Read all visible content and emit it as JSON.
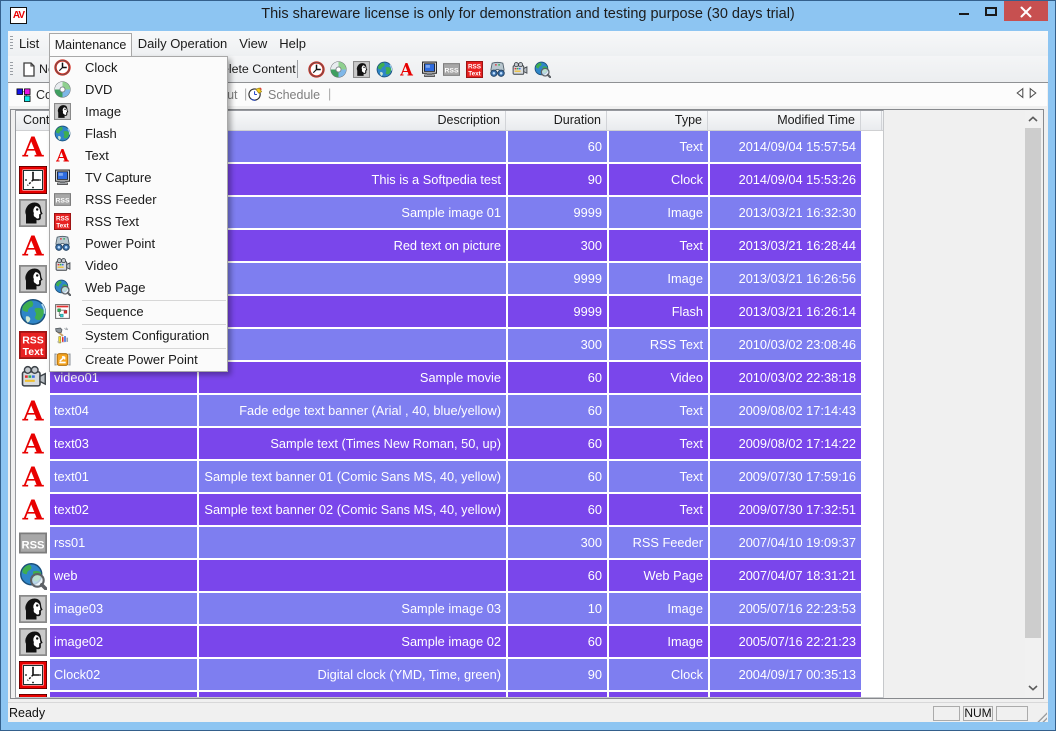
{
  "window": {
    "title": "This shareware license is only for demonstration and testing purpose (30 days trial)",
    "app_icon_text": "AV"
  },
  "menu_bar": {
    "items": [
      "List",
      "Maintenance",
      "Daily Operation",
      "View",
      "Help"
    ],
    "open_item": "Maintenance"
  },
  "maintenance_menu": {
    "items": [
      {
        "label": "Clock",
        "icon": "clock-icon"
      },
      {
        "label": "DVD",
        "icon": "dvd-icon"
      },
      {
        "label": "Image",
        "icon": "image-icon"
      },
      {
        "label": "Flash",
        "icon": "flash-icon"
      },
      {
        "label": "Text",
        "icon": "text-icon"
      },
      {
        "label": "TV Capture",
        "icon": "tv-capture-icon"
      },
      {
        "label": "RSS Feeder",
        "icon": "rss-feeder-icon"
      },
      {
        "label": "RSS Text",
        "icon": "rss-text-icon"
      },
      {
        "label": "Power Point",
        "icon": "power-point-icon"
      },
      {
        "label": "Video",
        "icon": "video-icon"
      },
      {
        "label": "Web Page",
        "icon": "web-page-icon"
      },
      {
        "separator": true
      },
      {
        "label": "Sequence",
        "icon": "sequence-icon"
      },
      {
        "separator": true
      },
      {
        "label": "System Configuration",
        "icon": "system-configuration-icon"
      },
      {
        "separator": true
      },
      {
        "label": "Create Power Point",
        "icon": "create-power-point-icon"
      }
    ]
  },
  "toolbar": {
    "new_button": {
      "label": "New Content",
      "icon": "new-content-icon"
    },
    "delete_button": {
      "label": "Delete Content",
      "icon": "delete-content-icon"
    },
    "icon_buttons": [
      {
        "name": "clock",
        "icon": "clock-icon"
      },
      {
        "name": "dvd",
        "icon": "dvd-icon"
      },
      {
        "name": "image",
        "icon": "image-icon"
      },
      {
        "name": "flash",
        "icon": "flash-icon"
      },
      {
        "name": "text",
        "icon": "text-icon"
      },
      {
        "name": "tv-capture",
        "icon": "tv-capture-icon"
      },
      {
        "name": "rss-feeder",
        "icon": "rss-feeder-icon"
      },
      {
        "name": "rss-text",
        "icon": "rss-text-icon"
      },
      {
        "name": "power-point",
        "icon": "power-point-icon"
      },
      {
        "name": "video",
        "icon": "video-icon"
      },
      {
        "name": "web-page",
        "icon": "web-page-icon"
      }
    ]
  },
  "tab_bar": {
    "tabs": [
      {
        "label": "Content",
        "icon": "content-tab-icon",
        "active": true
      },
      {
        "label": "Layout",
        "icon": "layout-tab-icon",
        "active": false
      },
      {
        "label": "Schedule",
        "icon": "schedule-tab-icon",
        "active": false
      }
    ]
  },
  "table": {
    "columns": [
      {
        "label": "Content Name",
        "align": "left"
      },
      {
        "label": "Description",
        "align": "right"
      },
      {
        "label": "Duration",
        "align": "right"
      },
      {
        "label": "Type",
        "align": "right"
      },
      {
        "label": "Modified Time",
        "align": "right"
      },
      {
        "label": "",
        "align": "left"
      }
    ],
    "rows": [
      {
        "icon": "text",
        "name": "",
        "description": "",
        "duration": "60",
        "type": "Text",
        "modified": "2014/09/04 15:57:54",
        "shade": "light"
      },
      {
        "icon": "clock",
        "name": "",
        "description": "This is a Softpedia test",
        "duration": "90",
        "type": "Clock",
        "modified": "2014/09/04 15:53:26",
        "shade": "dark"
      },
      {
        "icon": "image",
        "name": "",
        "description": "Sample image 01",
        "duration": "9999",
        "type": "Image",
        "modified": "2013/03/21 16:32:30",
        "shade": "light"
      },
      {
        "icon": "text",
        "name": "",
        "description": "Red text on picture",
        "duration": "300",
        "type": "Text",
        "modified": "2013/03/21 16:28:44",
        "shade": "dark"
      },
      {
        "icon": "image",
        "name": "",
        "description": "",
        "duration": "9999",
        "type": "Image",
        "modified": "2013/03/21 16:26:56",
        "shade": "light"
      },
      {
        "icon": "flash",
        "name": "",
        "description": "",
        "duration": "9999",
        "type": "Flash",
        "modified": "2013/03/21 16:26:14",
        "shade": "dark"
      },
      {
        "icon": "rss-text",
        "name": "",
        "description": "",
        "duration": "300",
        "type": "RSS Text",
        "modified": "2010/03/02 23:08:46",
        "shade": "light"
      },
      {
        "icon": "video",
        "name": "video01",
        "description": "Sample movie",
        "duration": "60",
        "type": "Video",
        "modified": "2010/03/02 22:38:18",
        "shade": "dark"
      },
      {
        "icon": "text",
        "name": "text04",
        "description": "Fade edge text banner (Arial , 40, blue/yellow)",
        "duration": "60",
        "type": "Text",
        "modified": "2009/08/02 17:14:43",
        "shade": "light"
      },
      {
        "icon": "text",
        "name": "text03",
        "description": "Sample text (Times New Roman, 50, up)",
        "duration": "60",
        "type": "Text",
        "modified": "2009/08/02 17:14:22",
        "shade": "dark"
      },
      {
        "icon": "text",
        "name": "text01",
        "description": "Sample text banner 01 (Comic Sans MS, 40, yellow)",
        "duration": "60",
        "type": "Text",
        "modified": "2009/07/30 17:59:16",
        "shade": "light"
      },
      {
        "icon": "text",
        "name": "text02",
        "description": "Sample text banner 02 (Comic Sans MS, 40, yellow)",
        "duration": "60",
        "type": "Text",
        "modified": "2009/07/30 17:32:51",
        "shade": "dark"
      },
      {
        "icon": "rss",
        "name": "rss01",
        "description": "",
        "duration": "300",
        "type": "RSS Feeder",
        "modified": "2007/04/10 19:09:37",
        "shade": "light"
      },
      {
        "icon": "web",
        "name": "web",
        "description": "",
        "duration": "60",
        "type": "Web Page",
        "modified": "2007/04/07 18:31:21",
        "shade": "dark"
      },
      {
        "icon": "image",
        "name": "image03",
        "description": "Sample image 03",
        "duration": "10",
        "type": "Image",
        "modified": "2005/07/16 22:23:53",
        "shade": "light"
      },
      {
        "icon": "image",
        "name": "image02",
        "description": "Sample image 02",
        "duration": "60",
        "type": "Image",
        "modified": "2005/07/16 22:21:23",
        "shade": "dark"
      },
      {
        "icon": "clock",
        "name": "Clock02",
        "description": "Digital clock (YMD, Time, green)",
        "duration": "90",
        "type": "Clock",
        "modified": "2004/09/17 00:35:13",
        "shade": "light"
      },
      {
        "icon": "clock",
        "name": "",
        "description": "",
        "duration": "",
        "type": "",
        "modified": "",
        "shade": "dark"
      }
    ]
  },
  "status_bar": {
    "ready_label": "Ready",
    "cells": [
      "",
      "NUM",
      ""
    ]
  },
  "colors": {
    "titlebar": "#8dc5f2",
    "close_button": "#c75050",
    "row_light": "#7e7ef0",
    "row_dark": "#7a46eb",
    "app_background": "#f0f0f0"
  }
}
